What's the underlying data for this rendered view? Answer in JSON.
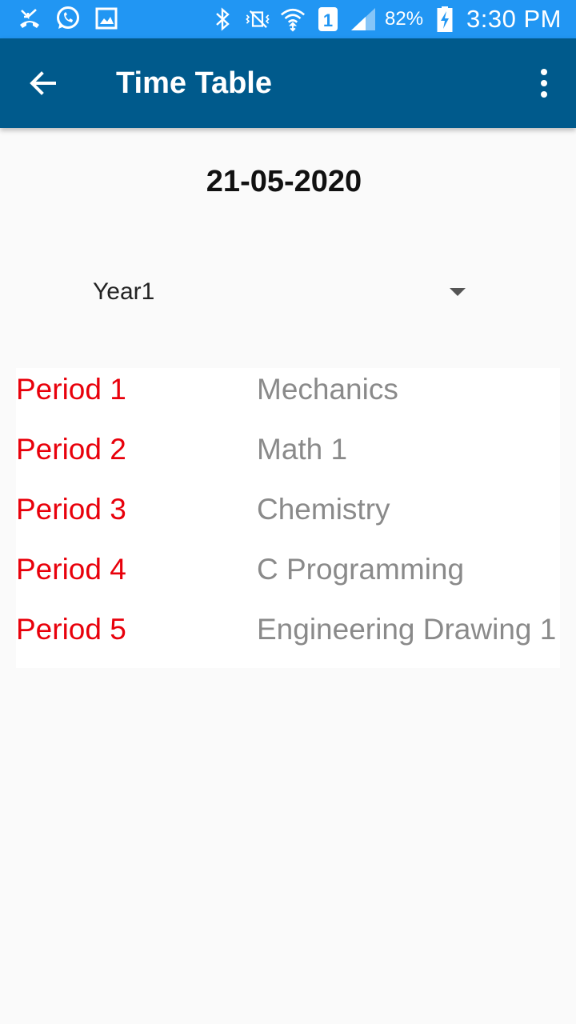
{
  "status_bar": {
    "icons_left": [
      "missed-call-icon",
      "whatsapp-icon",
      "image-icon"
    ],
    "icons_right": [
      "bluetooth-icon",
      "vibrate-mute-icon",
      "wifi-icon",
      "sim-1-icon",
      "signal-icon",
      "battery-charging-icon"
    ],
    "battery_percent": "82%",
    "clock": "3:30 PM",
    "color": "#2196f3"
  },
  "app_bar": {
    "title": "Time Table",
    "back_icon": "back-arrow-icon",
    "menu_icon": "more-vert-icon",
    "color": "#005a8c"
  },
  "date": "21-05-2020",
  "year_select": {
    "value": "Year1",
    "arrow_icon": "dropdown-arrow-icon"
  },
  "periods": [
    {
      "label": "Period 1",
      "subject": "Mechanics"
    },
    {
      "label": "Period 2",
      "subject": "Math 1"
    },
    {
      "label": "Period 3",
      "subject": "Chemistry"
    },
    {
      "label": "Period 4",
      "subject": "C Programming"
    },
    {
      "label": "Period 5",
      "subject": "Engineering Drawing 1"
    }
  ],
  "colors": {
    "period_label": "#e8000b",
    "period_subject": "#8a8a8a"
  }
}
